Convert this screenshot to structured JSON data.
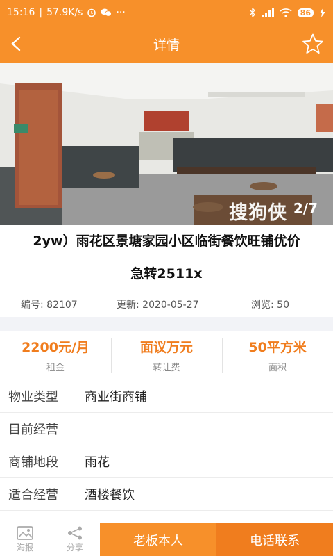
{
  "status_bar": {
    "time": "15:16",
    "speed": "57.9K/s",
    "dots": "···",
    "battery": "86"
  },
  "header": {
    "title": "详情",
    "back_icon": "chevron-left-icon",
    "favorite_icon": "star-outline-icon"
  },
  "gallery": {
    "counter": "2/7",
    "watermark": "搜狗侠"
  },
  "listing": {
    "title_line1": "2yw）雨花区景塘家园小区临街餐饮旺铺优价",
    "title_line2": "急转2511x",
    "id_label": "编号:",
    "id": "82107",
    "updated_label": "更新:",
    "updated": "2020-05-27",
    "views_label": "浏览:",
    "views": "50"
  },
  "stats": [
    {
      "value": "2200元/月",
      "label": "租金"
    },
    {
      "value": "面议万元",
      "label": "转让费"
    },
    {
      "value": "50平方米",
      "label": "面积"
    }
  ],
  "properties": [
    {
      "key": "物业类型",
      "value": "商业街商铺"
    },
    {
      "key": "目前经营",
      "value": ""
    },
    {
      "key": "商铺地段",
      "value": "雨花"
    },
    {
      "key": "适合经营",
      "value": "酒楼餐饮"
    }
  ],
  "bottom_bar": {
    "report_label": "海报",
    "share_label": "分享",
    "owner_label": "老板本人",
    "call_label": "电话联系"
  },
  "colors": {
    "brand": "#f7902a",
    "accent_text": "#f07d1e"
  }
}
